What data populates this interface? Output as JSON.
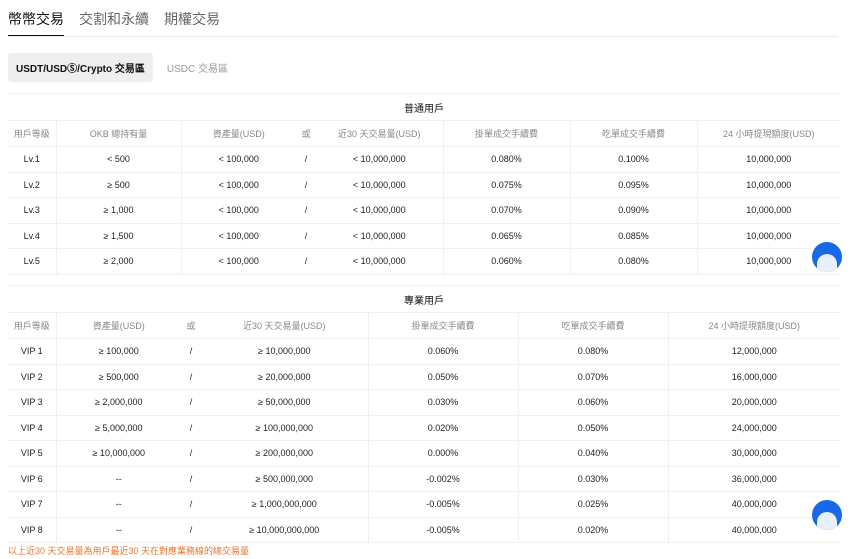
{
  "tabs": [
    "幣幣交易",
    "交割和永續",
    "期權交易"
  ],
  "subtabs": [
    "USDT/USDⓈ/Crypto 交易區",
    "USDC 交易區"
  ],
  "regular": {
    "title": "普通用戶",
    "headers": [
      "用戶等級",
      "OKB 總持有量",
      "資產量(USD)",
      "或",
      "近30 天交易量(USD)",
      "掛單成交手續費",
      "吃單成交手續費",
      "24 小時提現額度(USD)"
    ],
    "rows": [
      [
        "Lv.1",
        "< 500",
        "< 100,000",
        "/",
        "< 10,000,000",
        "0.080%",
        "0.100%",
        "10,000,000"
      ],
      [
        "Lv.2",
        "≥ 500",
        "< 100,000",
        "/",
        "< 10,000,000",
        "0.075%",
        "0.095%",
        "10,000,000"
      ],
      [
        "Lv.3",
        "≥ 1,000",
        "< 100,000",
        "/",
        "< 10,000,000",
        "0.070%",
        "0.090%",
        "10,000,000"
      ],
      [
        "Lv.4",
        "≥ 1,500",
        "< 100,000",
        "/",
        "< 10,000,000",
        "0.065%",
        "0.085%",
        "10,000,000"
      ],
      [
        "Lv.5",
        "≥ 2,000",
        "< 100,000",
        "/",
        "< 10,000,000",
        "0.060%",
        "0.080%",
        "10,000,000"
      ]
    ]
  },
  "pro": {
    "title": "專業用戶",
    "headers": [
      "用戶等級",
      "資產量(USD)",
      "或",
      "近30 天交易量(USD)",
      "掛單成交手續費",
      "吃單成交手續費",
      "24 小時提現額度(USD)"
    ],
    "rows": [
      [
        "VIP 1",
        "≥ 100,000",
        "/",
        "≥ 10,000,000",
        "0.060%",
        "0.080%",
        "12,000,000"
      ],
      [
        "VIP 2",
        "≥ 500,000",
        "/",
        "≥ 20,000,000",
        "0.050%",
        "0.070%",
        "16,000,000"
      ],
      [
        "VIP 3",
        "≥ 2,000,000",
        "/",
        "≥ 50,000,000",
        "0.030%",
        "0.060%",
        "20,000,000"
      ],
      [
        "VIP 4",
        "≥ 5,000,000",
        "/",
        "≥ 100,000,000",
        "0.020%",
        "0.050%",
        "24,000,000"
      ],
      [
        "VIP 5",
        "≥ 10,000,000",
        "/",
        "≥ 200,000,000",
        "0.000%",
        "0.040%",
        "30,000,000"
      ],
      [
        "VIP 6",
        "--",
        "/",
        "≥ 500,000,000",
        "-0.002%",
        "0.030%",
        "36,000,000"
      ],
      [
        "VIP 7",
        "--",
        "/",
        "≥ 1,000,000,000",
        "-0.005%",
        "0.025%",
        "40,000,000"
      ],
      [
        "VIP 8",
        "--",
        "/",
        "≥ 10,000,000,000",
        "-0.005%",
        "0.020%",
        "40,000,000"
      ]
    ]
  },
  "footnote": "以上近30 天交易量為用戶最近30 天在對應業務線的總交易量",
  "icons": {
    "support_button": "support-chat-icon"
  },
  "colors": {
    "accent": "#1769e8",
    "footnote": "#e6762f"
  }
}
